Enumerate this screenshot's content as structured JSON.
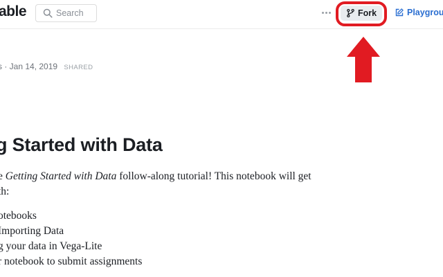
{
  "header": {
    "logo_text": "able",
    "search": {
      "placeholder": "Search",
      "value": ""
    },
    "more_label": "···",
    "fork_label": "Fork",
    "playground_label": "Playgrou"
  },
  "notebook": {
    "meta": {
      "date_text": "s · Jan 14, 2019",
      "badge": "SHARED"
    },
    "title": "g Started with Data",
    "intro": {
      "before": "e ",
      "emph": "Getting Started with Data",
      "after": " follow-along tutorial! This notebook will get",
      "line2": "th:"
    },
    "bullets": [
      "otebooks",
      " Importing Data",
      "g your data in Vega-Lite",
      "r notebook to submit assignments"
    ]
  },
  "colors": {
    "highlight_red": "#e11b22",
    "link_blue": "#2a6ed1",
    "fork_bg": "#e9ecef",
    "text_dark": "#1b1e23",
    "muted_gray": "#6e737a"
  },
  "icons": {
    "search": "search-icon",
    "more": "more-dots-icon",
    "fork": "fork-icon",
    "playground": "edit-square-icon",
    "annotation": "up-arrow-annotation"
  }
}
